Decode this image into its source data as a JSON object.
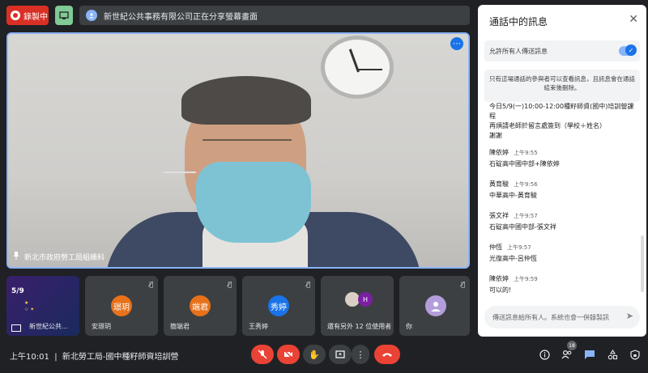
{
  "top": {
    "record_label": "錄製中",
    "share_text": "新世紀公共事務有限公司正在分享螢幕畫面"
  },
  "main_video": {
    "name": "新北市政府勞工局組織科"
  },
  "tiles": [
    {
      "name": "新世紀公共..."
    },
    {
      "name": "安璟玥",
      "avatar": "璟玥",
      "color": "#e8711a"
    },
    {
      "name": "簡端君",
      "avatar": "端君",
      "color": "#e8711a"
    },
    {
      "name": "王秀婷",
      "avatar": "秀婷",
      "color": "#1a73e8"
    },
    {
      "name": "還有另外 12 位使用者",
      "avatar": "H"
    },
    {
      "name": "你"
    }
  ],
  "poster": {
    "date": "5/9"
  },
  "bottom": {
    "time": "上午10:01",
    "meeting_title": "新北勞工局-國中種籽師資培訓營",
    "participants_count": "18"
  },
  "chat": {
    "title": "通話中的訊息",
    "allow_label": "允許所有人傳送訊息",
    "notice": "只有這場通話的參與者可以查看訊息，且訊息會在通話結束後刪除。",
    "pinned": "今日5/9(一)10:00-12:00種籽師資(國中)培訓營課程\n再煩請老師於留言處簽到（學校＋姓名）\n謝謝",
    "messages": [
      {
        "sender": "陳依婷",
        "time": "上午9:55",
        "text": "石碇高中國中部+陳依婷"
      },
      {
        "sender": "黃育駿",
        "time": "上午9:56",
        "text": "中華高中-黃育駿"
      },
      {
        "sender": "張文祥",
        "time": "上午9:57",
        "text": "石碇高中國中部-張文祥"
      },
      {
        "sender": "仲恆",
        "time": "上午9:57",
        "text": "光復高中-呂仲恆"
      },
      {
        "sender": "陳依婷",
        "time": "上午9:59",
        "text": "可以的!"
      }
    ],
    "input_placeholder": "傳送訊息給所有人。系統也會一併錄製訊"
  }
}
